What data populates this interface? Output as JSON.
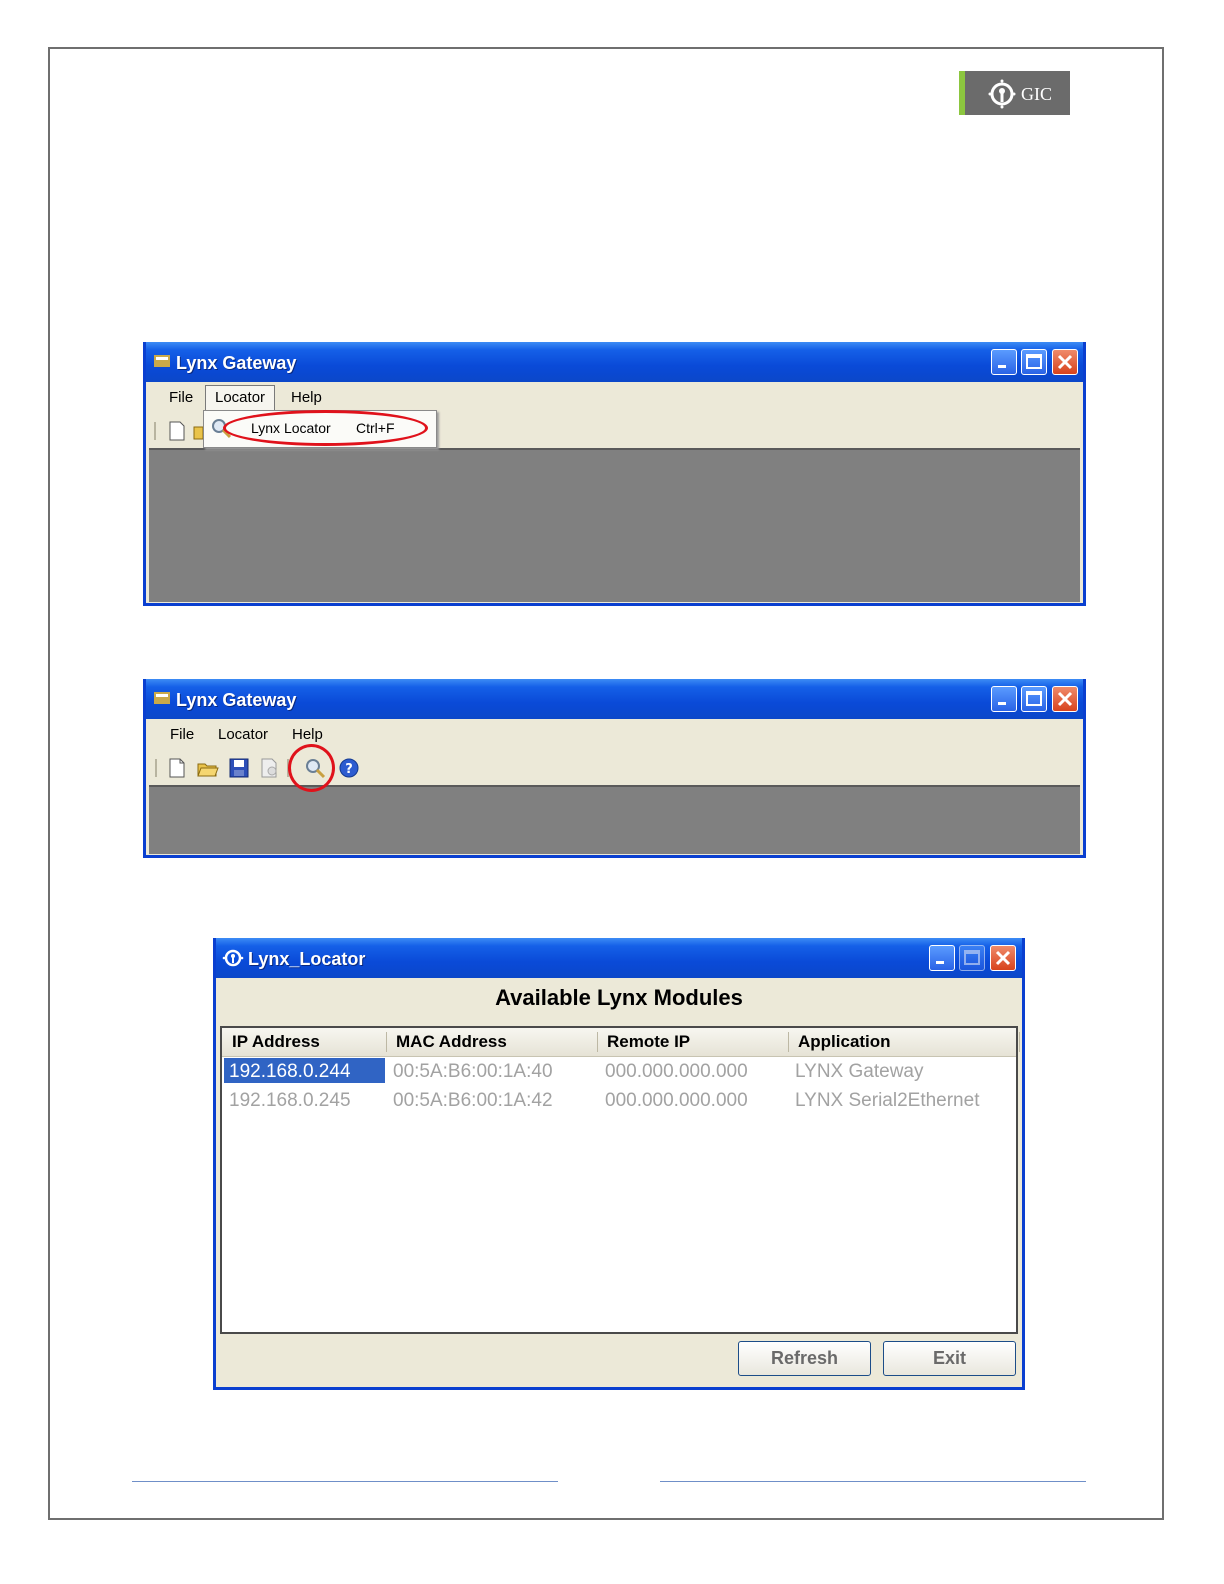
{
  "logo": {
    "text": "GIC",
    "accent_color": "#8cc63f"
  },
  "window1": {
    "title": "Lynx Gateway",
    "menu": [
      "File",
      "Locator",
      "Help"
    ],
    "dropdown": {
      "item_label": "Lynx Locator",
      "shortcut": "Ctrl+F"
    }
  },
  "window2": {
    "title": "Lynx Gateway",
    "menu": [
      "File",
      "Locator",
      "Help"
    ],
    "toolbar_icons": [
      "new-file-icon",
      "open-folder-icon",
      "save-icon",
      "print-preview-icon",
      "search-icon",
      "help-icon"
    ]
  },
  "locator": {
    "title": "Lynx_Locator",
    "heading": "Available Lynx Modules",
    "columns": [
      "IP Address",
      "MAC Address",
      "Remote IP",
      "Application"
    ],
    "rows": [
      [
        "192.168.0.244",
        "00:5A:B6:00:1A:40",
        "000.000.000.000",
        "LYNX Gateway"
      ],
      [
        "192.168.0.245",
        "00:5A:B6:00:1A:42",
        "000.000.000.000",
        "LYNX Serial2Ethernet"
      ]
    ],
    "buttons": {
      "refresh": "Refresh",
      "exit": "Exit"
    },
    "selection_color": "#3064c4"
  },
  "colors": {
    "titlebar": "#0a4ad8",
    "highlight_circle": "#e0121b",
    "window_body": "#ece9d8"
  }
}
